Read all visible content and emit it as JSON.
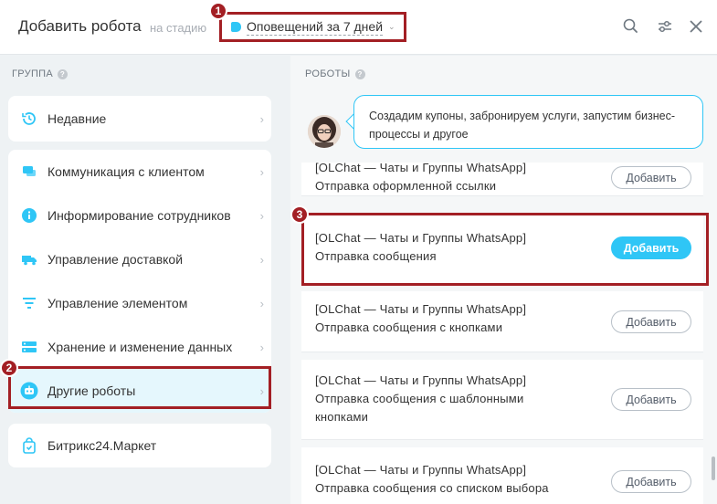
{
  "header": {
    "title": "Добавить робота",
    "stage_prefix": "на стадию",
    "stage_value": "Оповещений за 7 дней",
    "stage_caret": "⌄",
    "icons": [
      "search-icon",
      "filter-sliders-icon",
      "close-icon"
    ]
  },
  "badges": {
    "b1": "1",
    "b2": "2",
    "b3": "3"
  },
  "groups": {
    "label": "ГРУППА",
    "recent": "Недавние",
    "items": [
      "Коммуникация с клиентом",
      "Информирование сотрудников",
      "Управление доставкой",
      "Управление элементом",
      "Хранение и изменение данных",
      "Другие роботы"
    ],
    "market": "Битрикс24.Маркет"
  },
  "robots": {
    "label": "РОБОТЫ",
    "hint": "Создадим купоны, забронируем услуги, запустим бизнес-процессы и другое",
    "add_label": "Добавить",
    "items": [
      {
        "line1": "[OLChat — Чаты и Группы WhatsApp]",
        "line2": "Отправка оформленной ссылки",
        "line3": ""
      },
      {
        "line1": "[OLChat — Чаты и Группы WhatsApp]",
        "line2": "Отправка сообщения",
        "line3": ""
      },
      {
        "line1": "[OLChat — Чаты и Группы WhatsApp]",
        "line2": "Отправка сообщения с кнопками",
        "line3": ""
      },
      {
        "line1": "[OLChat — Чаты и Группы WhatsApp]",
        "line2": "Отправка сообщения с шаблонными",
        "line3": "кнопками"
      },
      {
        "line1": "[OLChat — Чаты и Группы WhatsApp]",
        "line2": "Отправка сообщения со списком выбора",
        "line3": ""
      }
    ]
  },
  "colors": {
    "accent": "#2fc6f6",
    "highlight": "#a31f24",
    "active_bg": "#e5f7fd"
  }
}
